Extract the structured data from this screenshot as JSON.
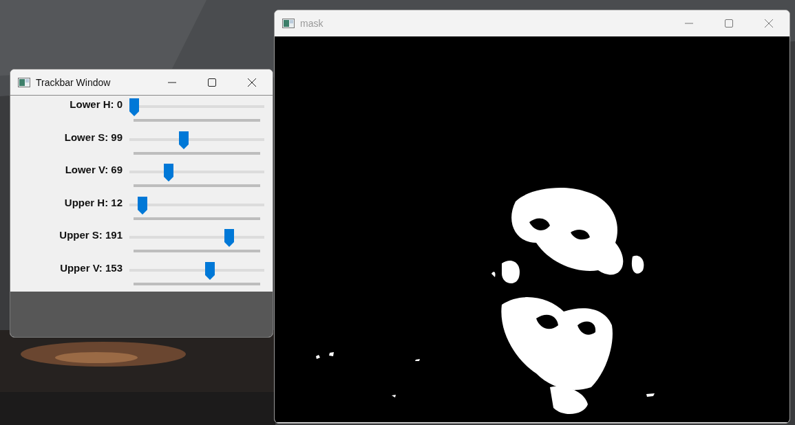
{
  "windows": [
    {
      "title": "Trackbar Window",
      "active": true,
      "sliders": [
        {
          "label": "Lower H: 0",
          "level": 0
        },
        {
          "label": "Lower S: 99",
          "level": 0.39
        },
        {
          "label": "Lower V: 69",
          "level": 0.27
        },
        {
          "label": "Upper H: 12",
          "level": 0.067
        },
        {
          "label": "Upper S: 191",
          "level": 0.75
        },
        {
          "label": "Upper V: 153",
          "level": 0.6
        }
      ]
    },
    {
      "title": "mask",
      "active": false
    }
  ]
}
